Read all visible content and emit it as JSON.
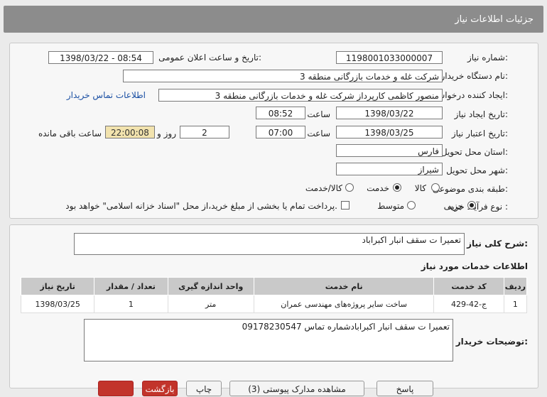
{
  "header": {
    "title": "جزئیات اطلاعات نیاز"
  },
  "info": {
    "need_number_label": "شماره نیاز:",
    "need_number": "1198001033000007",
    "announce_label": "تاریخ و ساعت اعلان عمومی:",
    "announce_value": "1398/03/22 - 08:54",
    "buyer_org_label": "نام دستگاه خریدار:",
    "buyer_org": "شرکت غله و خدمات بازرگانی منطقه 3",
    "requester_label": "ایجاد کننده درخواست:",
    "requester": "منصور کاظمی کارپرداز شرکت غله و خدمات بازرگانی منطقه 3",
    "contact_link": "اطلاعات تماس خریدار",
    "created_label": "تاریخ ایجاد نیاز:",
    "created_date": "1398/03/22",
    "time_label": "ساعت",
    "created_time": "08:52",
    "validity_label": "تاریخ اعتبار نیاز:",
    "validity_date": "1398/03/25",
    "validity_time": "07:00",
    "days_value": "2",
    "days_label": "روز و",
    "remaining_time": "22:00:08",
    "remaining_label": "ساعت باقی مانده",
    "province_label": "استان محل تحویل:",
    "province": "فارس",
    "city_label": "شهر محل تحویل:",
    "city": "شیراز",
    "category_label": "طبقه بندی موضوعی:",
    "category_options": [
      "کالا",
      "خدمت",
      "کالا/خدمت"
    ],
    "process_label": "نوع فرآیند خرید :",
    "process_options": [
      "جزیی",
      "متوسط"
    ],
    "payment_note": "پرداخت تمام یا بخشی از مبلغ خرید،از محل \"اسناد خزانه اسلامی\" خواهد بود."
  },
  "summary": {
    "label": "شرح کلی نیاز:",
    "value": "تعمیرا ت سقف انبار اکبراباد"
  },
  "services": {
    "title": "اطلاعات خدمات مورد نیاز",
    "columns": [
      "ردیف",
      "کد خدمت",
      "نام خدمت",
      "واحد اندازه گیری",
      "تعداد / مقدار",
      "تاریخ نیاز"
    ],
    "rows": [
      [
        "1",
        "ج-42-429",
        "ساخت سایر پروژه‌های مهندسی عمران",
        "متر",
        "1",
        "1398/03/25"
      ]
    ]
  },
  "buyer_notes": {
    "label": "توضیحات خریدار:",
    "value": "تعمیرا ت سقف انبار اکبرابادشماره تماس 09178230547"
  },
  "buttons": {
    "print": "چاپ",
    "view_docs": "مشاهده مدارک پیوستی (3)",
    "back": "بازگشت",
    "reply": "پاسخ"
  },
  "colors": {
    "header_bg": "#8c8c8c",
    "remaining_bg": "#f2e3ae",
    "link": "#1a4fa3"
  }
}
